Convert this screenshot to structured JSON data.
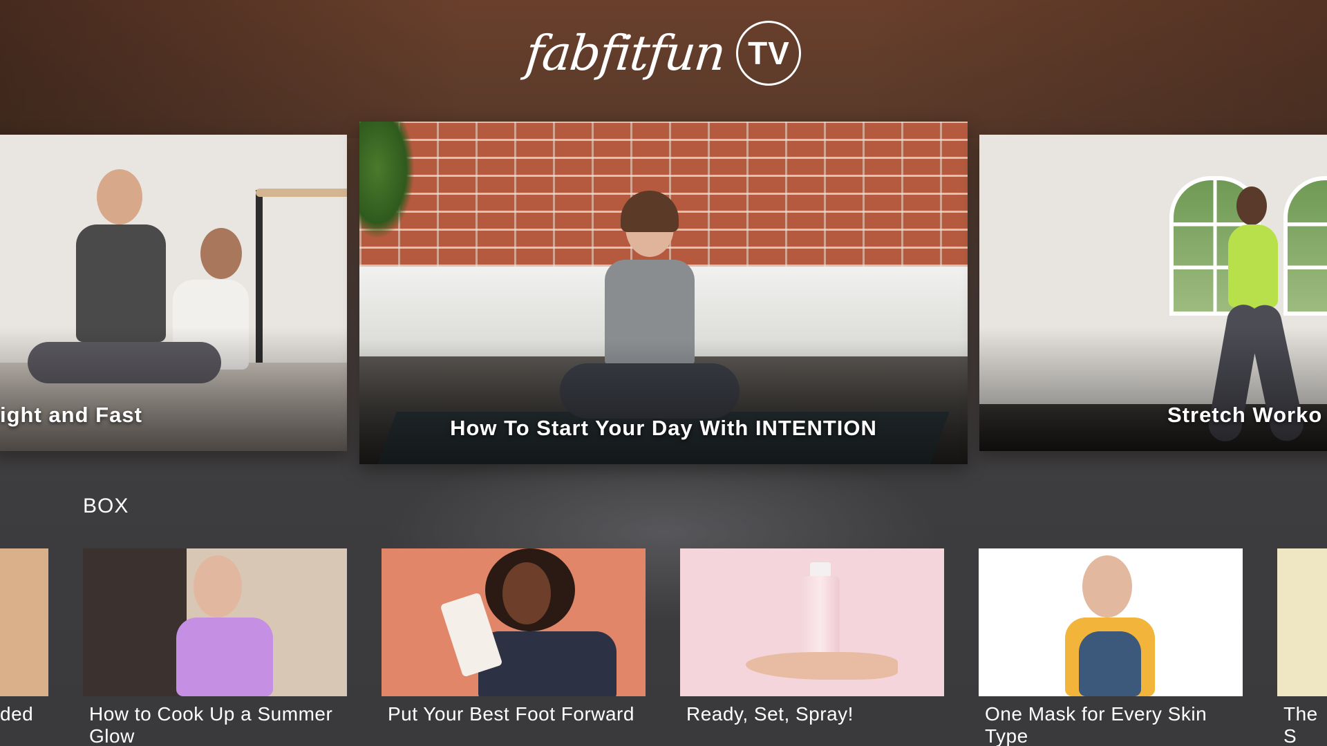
{
  "app": {
    "logo_script": "fabfitfun",
    "logo_badge": "TV"
  },
  "hero": {
    "left_title": "ight and Fast",
    "center_title": "How To Start Your Day With INTENTION",
    "right_title": "Stretch Worko"
  },
  "section": {
    "label": "BOX"
  },
  "row": {
    "partial_left_title": "ded",
    "items": [
      {
        "title": "How to Cook Up a Summer Glow"
      },
      {
        "title": "Put Your Best Foot Forward"
      },
      {
        "title": "Ready, Set, Spray!"
      },
      {
        "title": "One Mask for Every Skin Type"
      }
    ],
    "partial_right_title": "The S Sum"
  },
  "colors": {
    "header_brown": "#6a3f2c",
    "background": "#3b3b3d",
    "text": "#ffffff"
  }
}
